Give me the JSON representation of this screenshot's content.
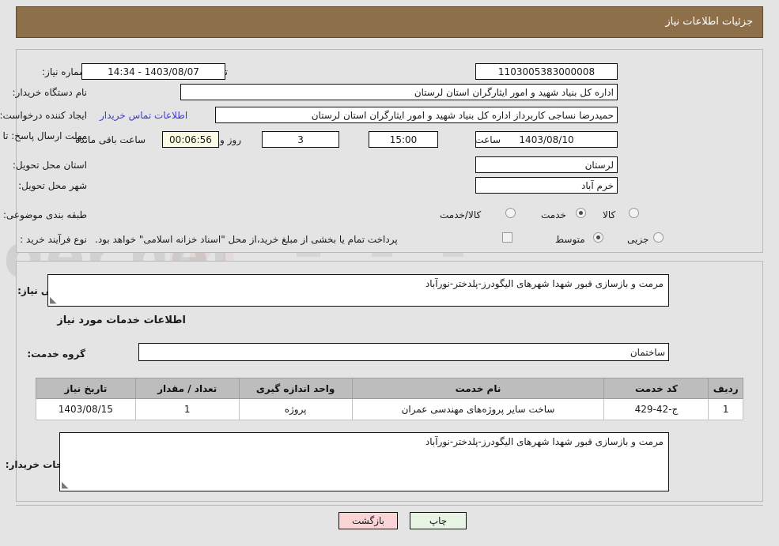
{
  "header": {
    "title": "جزئیات اطلاعات نیاز"
  },
  "fields": {
    "need_number_label": "شماره نیاز:",
    "need_number_value": "1103005383000008",
    "announce_datetime_label": "تاریخ و ساعت اعلان عمومی:",
    "announce_datetime_value": "1403/08/07 - 14:34",
    "buyer_org_label": "نام دستگاه خریدار:",
    "buyer_org_value": "اداره کل بنیاد شهید و امور ایثارگران استان لرستان",
    "requester_label": "ایجاد کننده درخواست:",
    "requester_value": "حمیدرضا نساجی کاربرداز اداره کل بنیاد شهید و امور ایثارگران استان لرستان",
    "buyer_contact_link": "اطلاعات تماس خریدار",
    "deadline_label": "مهلت ارسال پاسخ: تا تاریخ:",
    "deadline_date_value": "1403/08/10",
    "deadline_hour_label": "ساعت",
    "deadline_hour_value": "15:00",
    "remaining_days_value": "3",
    "remaining_days_label": "روز و",
    "remaining_time_value": "00:06:56",
    "remaining_time_label": "ساعت باقی مانده",
    "province_label": "استان محل تحویل:",
    "province_value": "لرستان",
    "city_label": "شهر محل تحویل:",
    "city_value": "خرم آباد",
    "category_label": "طبقه بندی موضوعی:",
    "category_options": [
      "کالا",
      "خدمت",
      "کالا/خدمت"
    ],
    "category_selected_index": 1,
    "process_label": "نوع فرآیند خرید :",
    "process_options": [
      "جزیی",
      "متوسط"
    ],
    "process_selected_index": 1,
    "treasury_checkbox_label": "پرداخت تمام یا بخشی از مبلغ خرید،از محل \"اسناد خزانه اسلامی\" خواهد بود.",
    "treasury_checked": false
  },
  "description": {
    "general_need_label": "شرح کلی نیاز:",
    "general_need_value": "مرمت و بازسازی قبور شهدا شهرهای الیگودرز-پلدختر-نورآباد",
    "services_info_heading": "اطلاعات خدمات مورد نیاز",
    "service_group_label": "گروه خدمت:",
    "service_group_value": "ساختمان",
    "buyer_notes_label": "توضیحات خریدار:",
    "buyer_notes_value": "مرمت و بازسازی قبور شهدا شهرهای الیگودرز-پلدختر-نورآباد"
  },
  "table": {
    "columns": [
      "ردیف",
      "کد خدمت",
      "نام خدمت",
      "واحد اندازه گیری",
      "تعداد / مقدار",
      "تاریخ نیاز"
    ],
    "rows": [
      {
        "row_no": "1",
        "service_code": "ج-42-429",
        "service_name": "ساخت سایر پروژه‌های مهندسی عمران",
        "unit": "پروژه",
        "quantity": "1",
        "need_date": "1403/08/15"
      }
    ]
  },
  "buttons": {
    "print": "چاپ",
    "back": "بازگشت"
  },
  "colors": {
    "header_bg": "#8d6f4a",
    "page_bg": "#e4e4e4",
    "panel_border": "#b9b9b9",
    "link": "#3b3bd0",
    "table_header_bg": "#bdbdbd",
    "print_btn_bg": "#e8f5e4",
    "back_btn_bg": "#fbd5d5",
    "countdown_bg": "#fbfbe4"
  }
}
